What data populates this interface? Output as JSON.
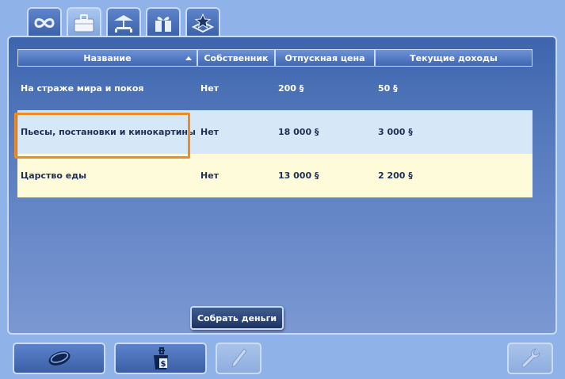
{
  "tabs": [
    {
      "icon": "infinity-icon"
    },
    {
      "icon": "briefcase-icon",
      "active": true
    },
    {
      "icon": "cafe-icon"
    },
    {
      "icon": "gift-box-icon"
    },
    {
      "icon": "star-map-icon"
    }
  ],
  "table": {
    "headers": [
      "Название",
      "Собственник",
      "Отпускная цена",
      "Текущие доходы"
    ],
    "rows": [
      {
        "name": "На страже мира и покоя",
        "owner": "Нет",
        "price": "200 §",
        "income": "50 §"
      },
      {
        "name": "Пьесы, постановки и кинокартины",
        "owner": "Нет",
        "price": "18 000 §",
        "income": "3 000 §"
      },
      {
        "name": "Царство еды",
        "owner": "Нет",
        "price": "13 000 §",
        "income": "2 200 §"
      }
    ]
  },
  "collect_button": "Собрать деньги",
  "colors": {
    "highlight": "#f08a24",
    "panel": "#3d65ad",
    "row_selected": "#d6e8f7",
    "row_alt": "#fdfbd9"
  }
}
